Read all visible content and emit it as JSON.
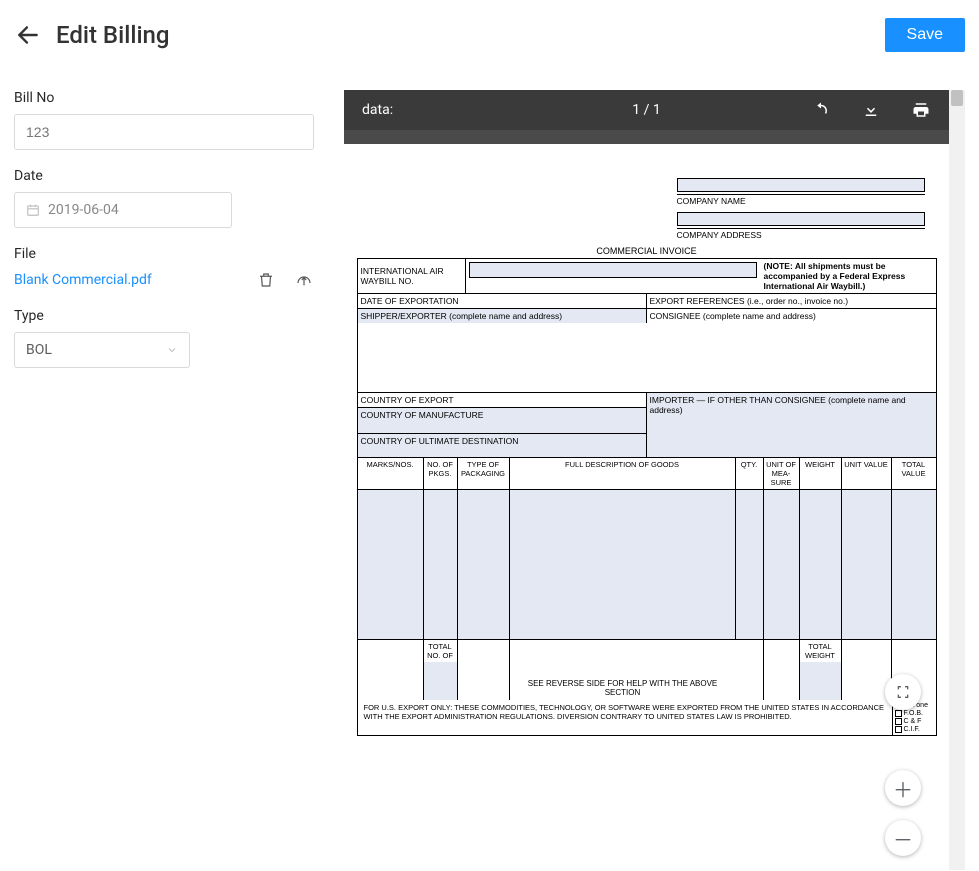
{
  "header": {
    "title": "Edit Billing",
    "save_label": "Save"
  },
  "form": {
    "bill_no_label": "Bill No",
    "bill_no_value": "123",
    "date_label": "Date",
    "date_value": "2019-06-04",
    "file_label": "File",
    "file_name": "Blank Commercial.pdf",
    "type_label": "Type",
    "type_value": "BOL"
  },
  "pdf_viewer": {
    "source_label": "data:",
    "page_indicator": "1 / 1"
  },
  "invoice": {
    "company_name_label": "COMPANY NAME",
    "company_address_label": "COMPANY ADDRESS",
    "title": "COMMERCIAL INVOICE",
    "iawb_label": "INTERNATIONAL AIR WAYBILL NO.",
    "note": "(NOTE: All shipments must be accompanied by a Federal Express International Air Waybill.)",
    "date_of_exportation": "DATE OF EXPORTATION",
    "export_references": "EXPORT REFERENCES (i.e., order no., invoice no.)",
    "shipper_exporter": "SHIPPER/EXPORTER (complete name and address)",
    "consignee": "CONSIGNEE (complete name and address)",
    "country_of_export": "COUNTRY OF EXPORT",
    "importer": "IMPORTER — IF OTHER THAN CONSIGNEE (complete name and address)",
    "country_of_manufacture": "COUNTRY OF MANUFACTURE",
    "country_of_ultimate_destination": "COUNTRY OF ULTIMATE DESTINATION",
    "columns": {
      "marks_nos": "MARKS/NOS.",
      "no_of_pkgs": "NO. OF PKGS.",
      "type_of_packaging": "TYPE OF PACKAGING",
      "full_description": "FULL DESCRIPTION OF GOODS",
      "qty": "QTY.",
      "unit_of_measure": "UNIT OF MEA-SURE",
      "weight": "WEIGHT",
      "unit_value": "UNIT VALUE",
      "total_value": "TOTAL VALUE"
    },
    "total_no_of_pkgs": "TOTAL NO. OF PKGS.",
    "total_weight": "TOTAL WEIGHT",
    "see_reverse": "SEE REVERSE SIDE FOR HELP WITH THE ABOVE SECTION",
    "export_disclaimer": "FOR U.S. EXPORT ONLY: THESE COMMODITIES, TECHNOLOGY, OR SOFTWARE WERE EXPORTED FROM THE UNITED STATES IN ACCORDANCE WITH THE EXPORT ADMINISTRATION REGULATIONS. DIVERSION CONTRARY TO UNITED STATES LAW IS PROHIBITED.",
    "check_one": "Check one",
    "fob": "F.O.B.",
    "cf": "C & F",
    "cif": "C.I.F."
  }
}
